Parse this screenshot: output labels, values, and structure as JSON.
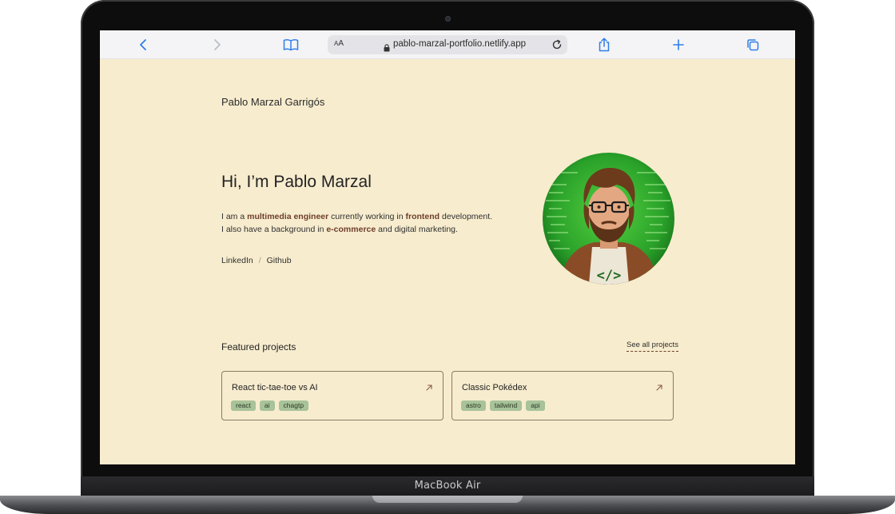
{
  "device": {
    "model_label": "MacBook Air"
  },
  "browser": {
    "text_size_label": "AA",
    "url": "pablo-marzal-portfolio.netlify.app"
  },
  "site": {
    "name": "Pablo Marzal Garrigós",
    "hero_title": "Hi, I’m Pablo Marzal",
    "bio_line1": {
      "pre": "I am a ",
      "highlight1": "multimedia engineer",
      "mid": " currently working in ",
      "highlight2": "frontend",
      "post": " development."
    },
    "bio_line2": {
      "pre": "I also have a background in ",
      "highlight": "e-commerce",
      "post": " and digital marketing."
    },
    "social": {
      "linkedin": "LinkedIn",
      "separator": "/",
      "github": "Github"
    },
    "featured": {
      "title": "Featured projects",
      "see_all": "See all projects",
      "projects": [
        {
          "title": "React tic-tae-toe vs AI",
          "tags": [
            "react",
            "ai",
            "chagtp"
          ]
        },
        {
          "title": "Classic Pokédex",
          "tags": [
            "astro",
            "tailwind",
            "api"
          ]
        }
      ]
    }
  },
  "colors": {
    "page_background": "#f7ecce",
    "accent_brown": "#6e3f2a",
    "tag_green": "#a8c29a",
    "safari_blue": "#2f7ee8"
  }
}
